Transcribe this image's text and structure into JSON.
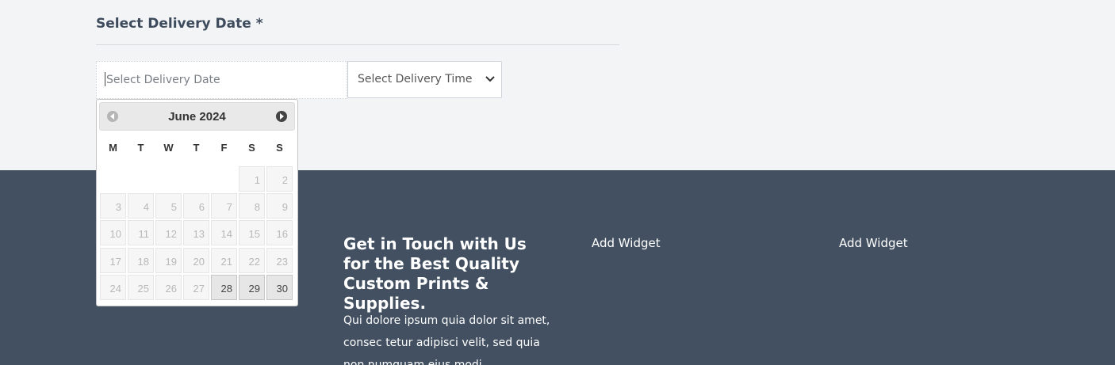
{
  "form": {
    "section_title": "Select Delivery Date *",
    "date_placeholder": "Select Delivery Date",
    "time_select_value": "Select Delivery Time"
  },
  "datepicker": {
    "month_label": "June 2024",
    "prev_label": "Prev",
    "next_label": "Next",
    "weekdays": [
      "M",
      "T",
      "W",
      "T",
      "F",
      "S",
      "S"
    ],
    "weeks": [
      [
        null,
        null,
        null,
        null,
        null,
        {
          "day": "1",
          "enabled": false
        },
        {
          "day": "2",
          "enabled": false
        }
      ],
      [
        {
          "day": "3",
          "enabled": false
        },
        {
          "day": "4",
          "enabled": false
        },
        {
          "day": "5",
          "enabled": false
        },
        {
          "day": "6",
          "enabled": false
        },
        {
          "day": "7",
          "enabled": false
        },
        {
          "day": "8",
          "enabled": false
        },
        {
          "day": "9",
          "enabled": false
        }
      ],
      [
        {
          "day": "10",
          "enabled": false
        },
        {
          "day": "11",
          "enabled": false
        },
        {
          "day": "12",
          "enabled": false
        },
        {
          "day": "13",
          "enabled": false
        },
        {
          "day": "14",
          "enabled": false
        },
        {
          "day": "15",
          "enabled": false
        },
        {
          "day": "16",
          "enabled": false
        }
      ],
      [
        {
          "day": "17",
          "enabled": false
        },
        {
          "day": "18",
          "enabled": false
        },
        {
          "day": "19",
          "enabled": false
        },
        {
          "day": "20",
          "enabled": false
        },
        {
          "day": "21",
          "enabled": false
        },
        {
          "day": "22",
          "enabled": false
        },
        {
          "day": "23",
          "enabled": false
        }
      ],
      [
        {
          "day": "24",
          "enabled": false
        },
        {
          "day": "25",
          "enabled": false
        },
        {
          "day": "26",
          "enabled": false
        },
        {
          "day": "27",
          "enabled": false
        },
        {
          "day": "28",
          "enabled": true
        },
        {
          "day": "29",
          "enabled": true
        },
        {
          "day": "30",
          "enabled": true
        }
      ]
    ]
  },
  "footer": {
    "heading": "Get in Touch with Us for the Best Quality Custom Prints & Supplies.",
    "body_text": "Qui dolore ipsum quia dolor sit amet, consec tetur adipisci velit, sed quia non numquam eius modi",
    "widget_1": "Add Widget",
    "widget_2": "Add Widget"
  },
  "colors": {
    "page_bg": "#f3f4f6",
    "footer_bg": "#425061",
    "title_color": "#3d4b5c"
  }
}
